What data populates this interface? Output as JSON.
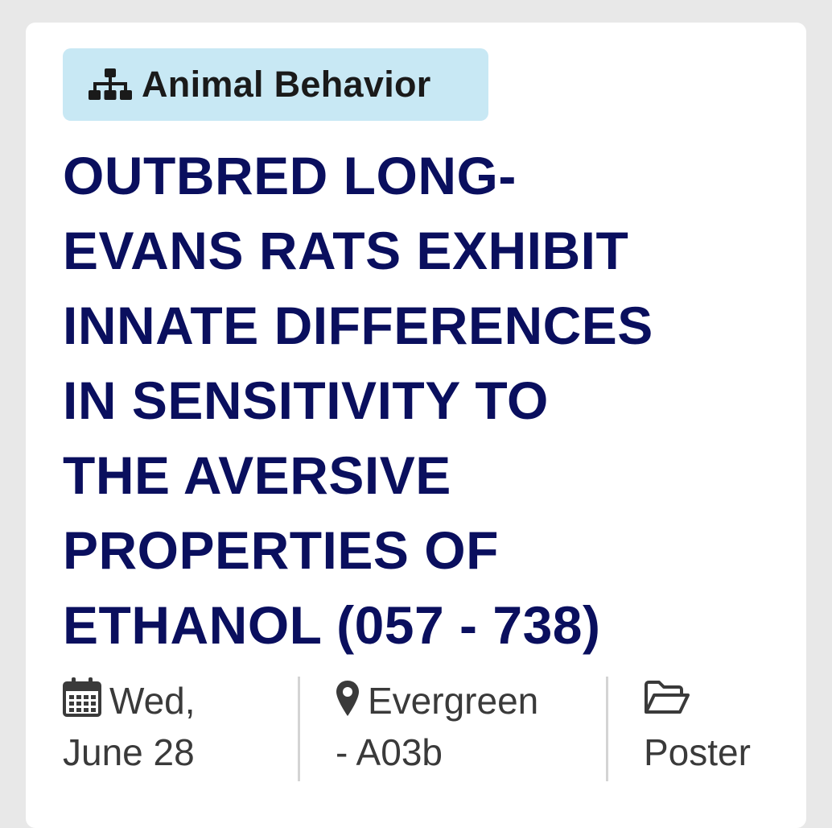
{
  "badge": {
    "icon": "sitemap-icon",
    "label": "Animal Behavior"
  },
  "title": {
    "lines": [
      "OUTBRED LONG-",
      "EVANS RATS EXHIBIT",
      "INNATE DIFFERENCES",
      "IN SENSITIVITY TO",
      "THE AVERSIVE",
      "PROPERTIES OF",
      "ETHANOL (057 - 738)"
    ]
  },
  "meta": {
    "date": {
      "icon": "calendar-icon",
      "line1": "Wed,",
      "line2": "June 28"
    },
    "location": {
      "icon": "map-pin-icon",
      "line1": "Evergreen",
      "line2": "- A03b"
    },
    "type": {
      "icon": "folder-open-icon",
      "line2": "Poster"
    }
  },
  "colors": {
    "page_bg": "#e8e8e8",
    "card_bg": "#ffffff",
    "badge_bg": "#c8e8f4",
    "title": "#0a0f5e",
    "meta_text": "#3a3a3a",
    "divider": "#d4d4d4"
  }
}
